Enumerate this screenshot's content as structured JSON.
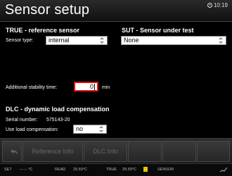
{
  "header": {
    "title": "Sensor setup",
    "time": "10:19"
  },
  "true_section": {
    "heading": "TRUE - reference sensor",
    "sensor_type_label": "Sensor type:",
    "sensor_type_value": "internal"
  },
  "sut_section": {
    "heading": "SUT - Sensor under test",
    "sensor_value": "None"
  },
  "stability": {
    "label": "Additional stability time:",
    "value": "0",
    "unit": "min"
  },
  "dlc_section": {
    "heading": "DLC - dynamic load compensation",
    "serial_label": "Serial number:",
    "serial_value": "575143-20",
    "use_label": "Use load compensation:",
    "use_value": "no"
  },
  "toolbar": {
    "reference_info": "Reference Info",
    "dlc_info": "DLC Info"
  },
  "statusbar": {
    "set_label": "SET",
    "set_value": "---.-- °C",
    "read_label": "READ",
    "read_value": "29.59°C",
    "true_label": "TRUE",
    "true_value": "29.59°C",
    "sensor_label": "SENSOR",
    "indicator_color": "#e6c300"
  }
}
